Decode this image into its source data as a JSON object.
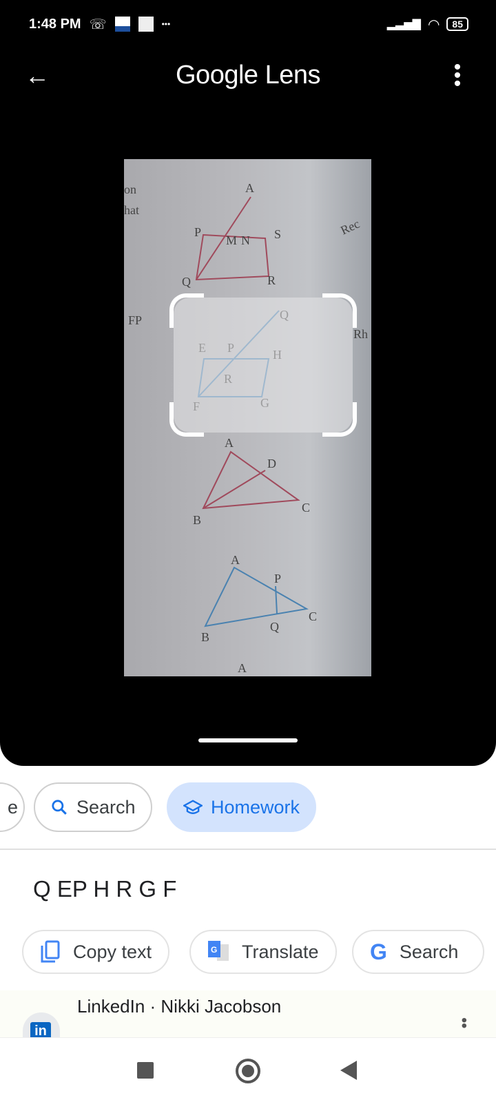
{
  "status_bar": {
    "time": "1:48 PM",
    "battery": "85",
    "more": "•••",
    "icons": [
      "missed-call-icon",
      "app-notification-icon",
      "app-notification-icon",
      "signal-icon",
      "wifi-icon",
      "battery-icon"
    ]
  },
  "app_bar": {
    "title": "Google Lens",
    "back": "←",
    "menu": "⋮"
  },
  "photo": {
    "labels": [
      "A",
      "P",
      "M",
      "N",
      "S",
      "Q",
      "R",
      "Q",
      "E",
      "P",
      "H",
      "R",
      "F",
      "G",
      "A",
      "D",
      "B",
      "C",
      "A",
      "P",
      "C",
      "B",
      "Q",
      "A",
      "FP",
      "on",
      "hat",
      "Rec",
      "Rh"
    ]
  },
  "modes": [
    {
      "label": "e",
      "icon": "translate-icon"
    },
    {
      "label": "Search",
      "icon": "search-icon"
    },
    {
      "label": "Homework",
      "icon": "graduation-cap-icon",
      "active": true
    }
  ],
  "ocr_text": "Q EP H R G F",
  "actions": [
    {
      "label": "Copy text",
      "icon": "copy-icon"
    },
    {
      "label": "Translate",
      "icon": "google-translate-icon"
    },
    {
      "label": "Search",
      "icon": "google-g-icon"
    }
  ],
  "result": {
    "title": "LinkedIn · Nikki Jacobson",
    "logo": "in",
    "more": "⋮"
  },
  "colors": {
    "accent": "#1a73e8",
    "chip_active": "#d3e3fd"
  }
}
